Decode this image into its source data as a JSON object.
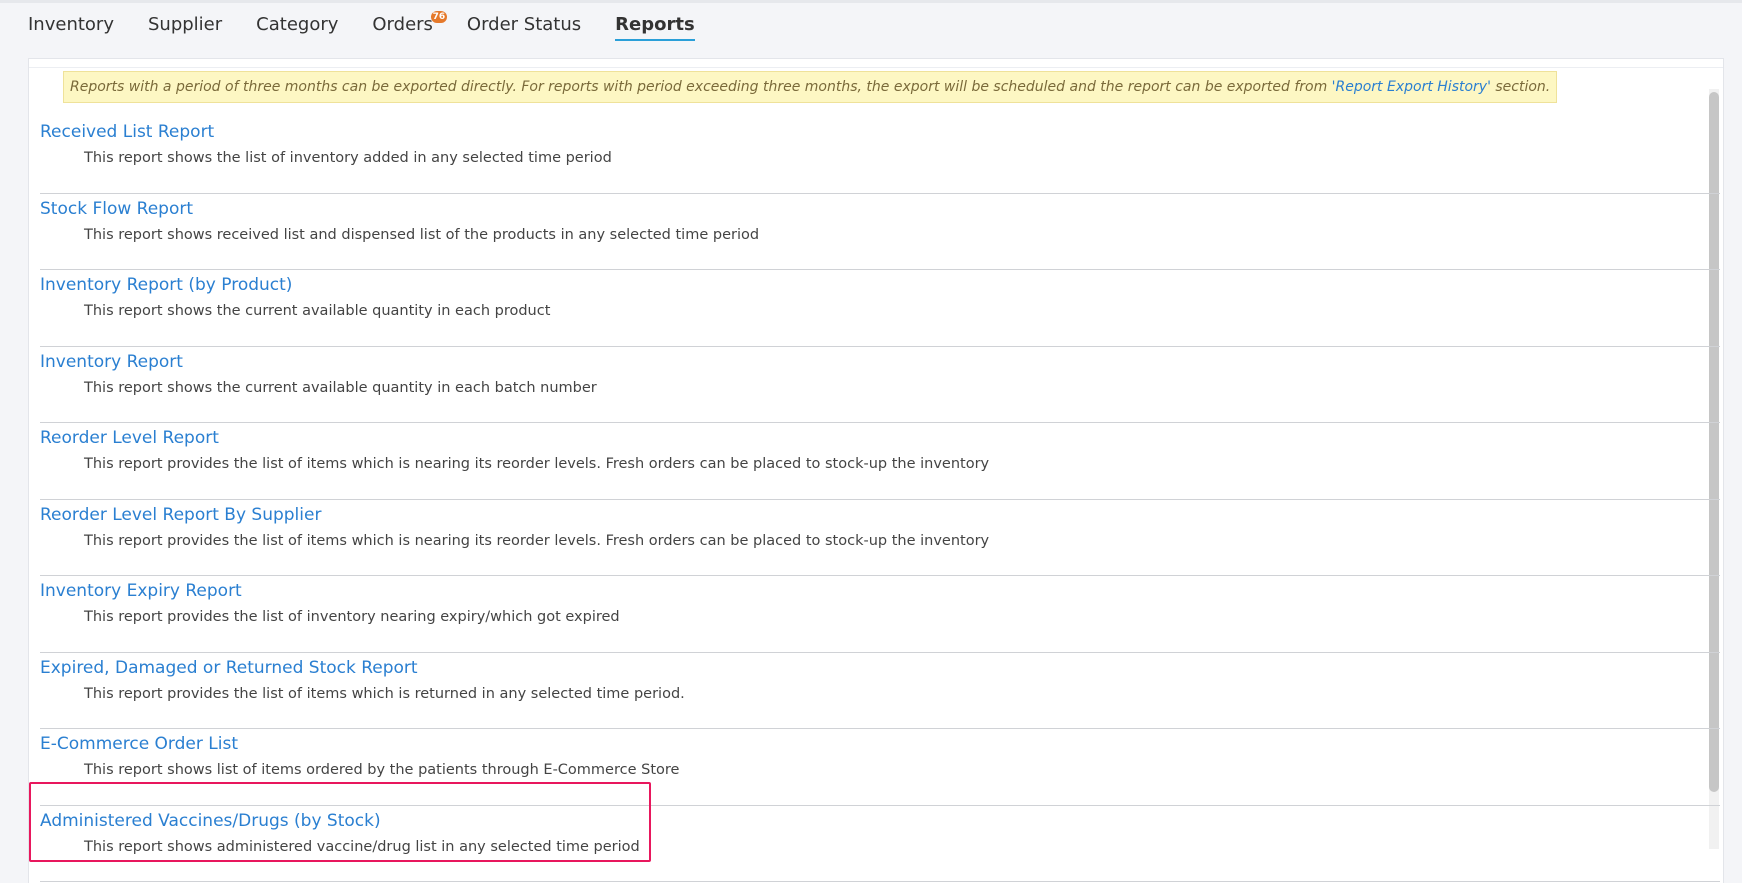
{
  "tabs": [
    {
      "label": "Inventory"
    },
    {
      "label": "Supplier"
    },
    {
      "label": "Category"
    },
    {
      "label": "Orders",
      "badge": "76"
    },
    {
      "label": "Order Status"
    },
    {
      "label": "Reports",
      "active": true
    }
  ],
  "notice": {
    "text_before": "Reports with a period of three months can be exported directly. For reports with period exceeding three months, the export will be scheduled and the report can be exported from ",
    "link_text": "'Report Export History'",
    "text_after": " section."
  },
  "reports": [
    {
      "title": "Received List Report",
      "description": "This report shows the list of inventory added in any selected time period"
    },
    {
      "title": "Stock Flow Report",
      "description": "This report shows received list and dispensed list of the products in any selected time period"
    },
    {
      "title": "Inventory Report (by Product)",
      "description": "This report shows the current available quantity in each product"
    },
    {
      "title": "Inventory Report",
      "description": "This report shows the current available quantity in each batch number"
    },
    {
      "title": "Reorder Level Report",
      "description": "This report provides the list of items which is nearing its reorder levels. Fresh orders can be placed to stock-up the inventory"
    },
    {
      "title": "Reorder Level Report By Supplier",
      "description": "This report provides the list of items which is nearing its reorder levels. Fresh orders can be placed to stock-up the inventory"
    },
    {
      "title": "Inventory Expiry Report",
      "description": "This report provides the list of inventory nearing expiry/which got expired"
    },
    {
      "title": "Expired, Damaged or Returned Stock Report",
      "description": "This report provides the list of items which is returned in any selected time period."
    },
    {
      "title": "E-Commerce Order List",
      "description": "This report shows list of items ordered by the patients through E-Commerce Store"
    },
    {
      "title": "Administered Vaccines/Drugs (by Stock)",
      "description": "This report shows administered vaccine/drug list in any selected time period"
    }
  ],
  "colors": {
    "link": "#2a7fd1",
    "active_tab_underline": "#2a9fd8",
    "badge": "#e5792b",
    "notice_bg": "#fdf7c3",
    "highlight": "#e8175d"
  }
}
